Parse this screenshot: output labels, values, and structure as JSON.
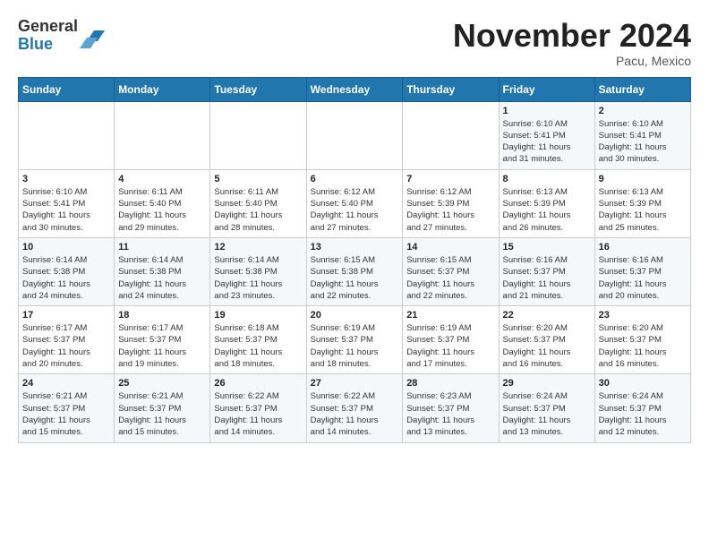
{
  "header": {
    "logo_general": "General",
    "logo_blue": "Blue",
    "month_title": "November 2024",
    "location": "Pacu, Mexico"
  },
  "calendar": {
    "weekdays": [
      "Sunday",
      "Monday",
      "Tuesday",
      "Wednesday",
      "Thursday",
      "Friday",
      "Saturday"
    ],
    "weeks": [
      [
        {
          "day": "",
          "info": ""
        },
        {
          "day": "",
          "info": ""
        },
        {
          "day": "",
          "info": ""
        },
        {
          "day": "",
          "info": ""
        },
        {
          "day": "",
          "info": ""
        },
        {
          "day": "1",
          "info": "Sunrise: 6:10 AM\nSunset: 5:41 PM\nDaylight: 11 hours\nand 31 minutes."
        },
        {
          "day": "2",
          "info": "Sunrise: 6:10 AM\nSunset: 5:41 PM\nDaylight: 11 hours\nand 30 minutes."
        }
      ],
      [
        {
          "day": "3",
          "info": "Sunrise: 6:10 AM\nSunset: 5:41 PM\nDaylight: 11 hours\nand 30 minutes."
        },
        {
          "day": "4",
          "info": "Sunrise: 6:11 AM\nSunset: 5:40 PM\nDaylight: 11 hours\nand 29 minutes."
        },
        {
          "day": "5",
          "info": "Sunrise: 6:11 AM\nSunset: 5:40 PM\nDaylight: 11 hours\nand 28 minutes."
        },
        {
          "day": "6",
          "info": "Sunrise: 6:12 AM\nSunset: 5:40 PM\nDaylight: 11 hours\nand 27 minutes."
        },
        {
          "day": "7",
          "info": "Sunrise: 6:12 AM\nSunset: 5:39 PM\nDaylight: 11 hours\nand 27 minutes."
        },
        {
          "day": "8",
          "info": "Sunrise: 6:13 AM\nSunset: 5:39 PM\nDaylight: 11 hours\nand 26 minutes."
        },
        {
          "day": "9",
          "info": "Sunrise: 6:13 AM\nSunset: 5:39 PM\nDaylight: 11 hours\nand 25 minutes."
        }
      ],
      [
        {
          "day": "10",
          "info": "Sunrise: 6:14 AM\nSunset: 5:38 PM\nDaylight: 11 hours\nand 24 minutes."
        },
        {
          "day": "11",
          "info": "Sunrise: 6:14 AM\nSunset: 5:38 PM\nDaylight: 11 hours\nand 24 minutes."
        },
        {
          "day": "12",
          "info": "Sunrise: 6:14 AM\nSunset: 5:38 PM\nDaylight: 11 hours\nand 23 minutes."
        },
        {
          "day": "13",
          "info": "Sunrise: 6:15 AM\nSunset: 5:38 PM\nDaylight: 11 hours\nand 22 minutes."
        },
        {
          "day": "14",
          "info": "Sunrise: 6:15 AM\nSunset: 5:37 PM\nDaylight: 11 hours\nand 22 minutes."
        },
        {
          "day": "15",
          "info": "Sunrise: 6:16 AM\nSunset: 5:37 PM\nDaylight: 11 hours\nand 21 minutes."
        },
        {
          "day": "16",
          "info": "Sunrise: 6:16 AM\nSunset: 5:37 PM\nDaylight: 11 hours\nand 20 minutes."
        }
      ],
      [
        {
          "day": "17",
          "info": "Sunrise: 6:17 AM\nSunset: 5:37 PM\nDaylight: 11 hours\nand 20 minutes."
        },
        {
          "day": "18",
          "info": "Sunrise: 6:17 AM\nSunset: 5:37 PM\nDaylight: 11 hours\nand 19 minutes."
        },
        {
          "day": "19",
          "info": "Sunrise: 6:18 AM\nSunset: 5:37 PM\nDaylight: 11 hours\nand 18 minutes."
        },
        {
          "day": "20",
          "info": "Sunrise: 6:19 AM\nSunset: 5:37 PM\nDaylight: 11 hours\nand 18 minutes."
        },
        {
          "day": "21",
          "info": "Sunrise: 6:19 AM\nSunset: 5:37 PM\nDaylight: 11 hours\nand 17 minutes."
        },
        {
          "day": "22",
          "info": "Sunrise: 6:20 AM\nSunset: 5:37 PM\nDaylight: 11 hours\nand 16 minutes."
        },
        {
          "day": "23",
          "info": "Sunrise: 6:20 AM\nSunset: 5:37 PM\nDaylight: 11 hours\nand 16 minutes."
        }
      ],
      [
        {
          "day": "24",
          "info": "Sunrise: 6:21 AM\nSunset: 5:37 PM\nDaylight: 11 hours\nand 15 minutes."
        },
        {
          "day": "25",
          "info": "Sunrise: 6:21 AM\nSunset: 5:37 PM\nDaylight: 11 hours\nand 15 minutes."
        },
        {
          "day": "26",
          "info": "Sunrise: 6:22 AM\nSunset: 5:37 PM\nDaylight: 11 hours\nand 14 minutes."
        },
        {
          "day": "27",
          "info": "Sunrise: 6:22 AM\nSunset: 5:37 PM\nDaylight: 11 hours\nand 14 minutes."
        },
        {
          "day": "28",
          "info": "Sunrise: 6:23 AM\nSunset: 5:37 PM\nDaylight: 11 hours\nand 13 minutes."
        },
        {
          "day": "29",
          "info": "Sunrise: 6:24 AM\nSunset: 5:37 PM\nDaylight: 11 hours\nand 13 minutes."
        },
        {
          "day": "30",
          "info": "Sunrise: 6:24 AM\nSunset: 5:37 PM\nDaylight: 11 hours\nand 12 minutes."
        }
      ]
    ]
  }
}
